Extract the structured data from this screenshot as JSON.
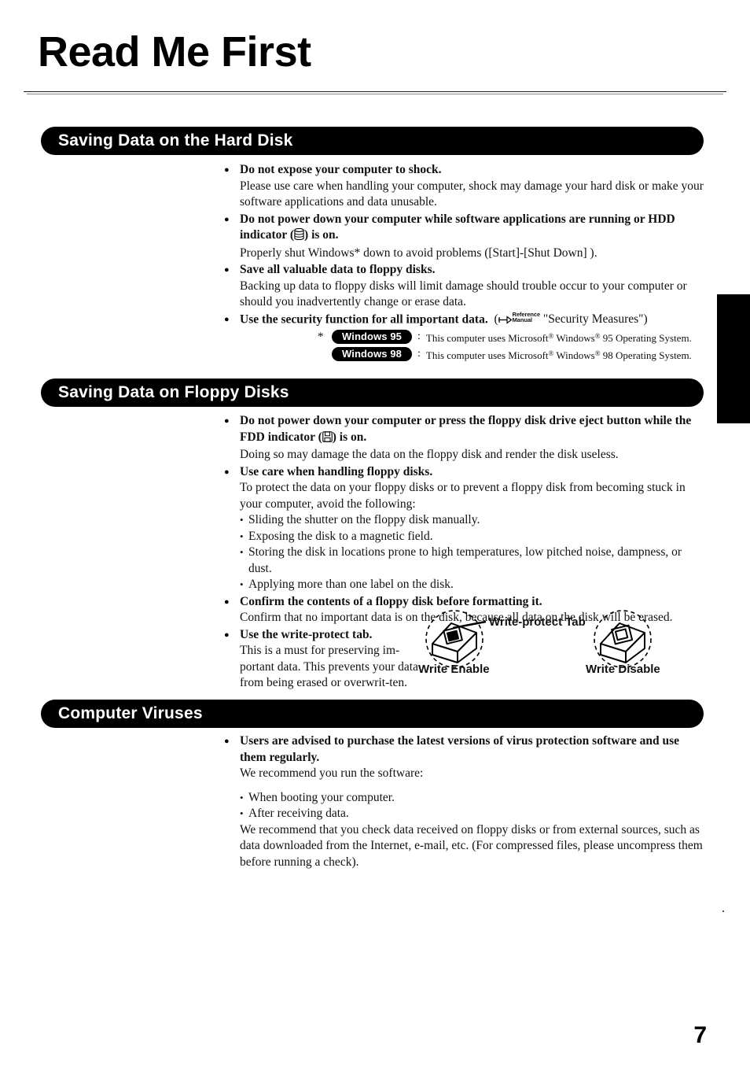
{
  "document": {
    "title": "Read Me First",
    "page_number": "7"
  },
  "sections": [
    {
      "heading": "Saving Data on the Hard Disk",
      "bullets": [
        {
          "lead": "Do not expose your computer to shock.",
          "body": "Please use care when handling your computer, shock may damage your hard disk or make your software applications and data unusable."
        },
        {
          "lead_part1": "Do not power down your computer while software applications are running or HDD indicator (",
          "lead_icon": "hdd-icon",
          "lead_part2": ") is on.",
          "body": "Properly shut Windows* down to avoid problems ([Start]-[Shut Down] )."
        },
        {
          "lead": "Save all valuable data to floppy disks.",
          "body": "Backing up data to floppy disks will limit damage should trouble occur to your computer or should you inadvertently change or erase data."
        },
        {
          "lead_part1": "Use the security function for all important data.",
          "ref_open": "(",
          "ref_icon": "pointing-hand-icon",
          "ref_manual_line1": "Reference",
          "ref_manual_line2": "Manual",
          "ref_quote": "\"Security Measures\")"
        }
      ],
      "footnotes": [
        {
          "star": "*",
          "badge": "Windows 95",
          "colon": ":",
          "text_part1": "This computer uses Microsoft",
          "reg1": "®",
          "text_part2": " Windows",
          "reg2": "®",
          "text_part3": " 95 Operating System."
        },
        {
          "star": "",
          "badge": "Windows 98",
          "colon": ":",
          "text_part1": "This computer uses Microsoft",
          "reg1": "®",
          "text_part2": " Windows",
          "reg2": "®",
          "text_part3": " 98 Operating System."
        }
      ]
    },
    {
      "heading": "Saving Data on Floppy Disks",
      "bullets": [
        {
          "lead_part1": "Do not power down your computer or press the floppy disk drive eject button while the FDD indicator (",
          "lead_icon": "floppy-disk-icon",
          "lead_part2": ") is on.",
          "body": "Doing so may damage the data on the floppy disk and render the disk useless."
        },
        {
          "lead": "Use care when handling floppy disks.",
          "body": "To protect the data on your floppy disks or to prevent a floppy disk from becoming stuck in your computer, avoid the following:",
          "sub_items": [
            "Sliding the shutter on the floppy disk manually.",
            "Exposing the disk to a magnetic field.",
            "Storing the disk in locations prone to high temperatures, low pitched noise, dampness, or dust.",
            "Applying more than one label on the disk."
          ]
        },
        {
          "lead": "Confirm the contents of a floppy disk before formatting it.",
          "body": "Confirm that no important data is on the disk, because all data on the disk will be erased."
        },
        {
          "lead": "Use the write-protect tab.",
          "body": "This is a must for preserving im-portant data.  This prevents your data from being erased or overwrit-ten."
        }
      ],
      "figure": {
        "tab_label": "Write-protect Tab",
        "caption_enable": "Write Enable",
        "caption_disable": "Write Disable"
      }
    },
    {
      "heading": "Computer Viruses",
      "bullets": [
        {
          "lead": "Users are advised to purchase the latest versions of virus protection software and use them regularly.",
          "body": "We recommend you run the software:",
          "sub_items": [
            "When booting your computer.",
            "After receiving data."
          ],
          "body2": "We recommend that you check data received on floppy disks or from external sources, such as data downloaded from the Internet, e-mail, etc.  (For compressed files, please uncompress them before running a check)."
        }
      ]
    }
  ],
  "colors": {
    "pill_background": "#000000",
    "pill_text": "#ffffff",
    "body_text": "#111111",
    "edge_tab": "#000000"
  }
}
